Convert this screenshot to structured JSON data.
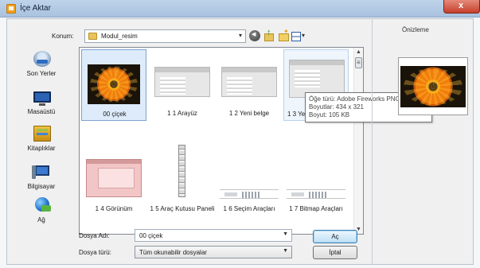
{
  "window": {
    "title": "İçe Aktar",
    "close_glyph": "x"
  },
  "location": {
    "label": "Konum:",
    "value": "Modul_resim",
    "arrow": "▾"
  },
  "toolbar": {
    "icons": [
      "back-icon",
      "up-folder-icon",
      "new-folder-icon",
      "views-menu-icon"
    ]
  },
  "places": [
    {
      "label": "Son Yerler",
      "icon": "recent-places-icon"
    },
    {
      "label": "Masaüstü",
      "icon": "desktop-icon"
    },
    {
      "label": "Kitaplıklar",
      "icon": "libraries-icon"
    },
    {
      "label": "Bilgisayar",
      "icon": "computer-icon"
    },
    {
      "label": "Ağ",
      "icon": "network-icon"
    }
  ],
  "files": [
    {
      "label": "00 çiçek",
      "selected": true
    },
    {
      "label": "1 1 Arayüz"
    },
    {
      "label": "1 2 Yeni belge"
    },
    {
      "label": "1 3 Yeni"
    },
    {
      "label": "1 4 Görünüm"
    },
    {
      "label": "1 5 Araç Kutusu Paneli"
    },
    {
      "label": "1 6 Seçim Araçları"
    },
    {
      "label": "1 7 Bitmap Araçları"
    }
  ],
  "tooltip": {
    "line1": "Öğe türü: Adobe Fireworks PNG File",
    "line2": "Boyutlar: 434 x 321",
    "line3": "Boyut: 105 KB"
  },
  "filename": {
    "label": "Dosya Adı:",
    "value": "00 çiçek"
  },
  "filetype": {
    "label": "Dosya türü:",
    "value": "Tüm okunabilir dosyalar"
  },
  "buttons": {
    "open": "Aç",
    "cancel": "İptal"
  },
  "preview": {
    "title": "Önizleme"
  },
  "colors": {
    "selection": "#ddebfa",
    "titlebar": "#bfd3ea",
    "close": "#c6402c"
  }
}
